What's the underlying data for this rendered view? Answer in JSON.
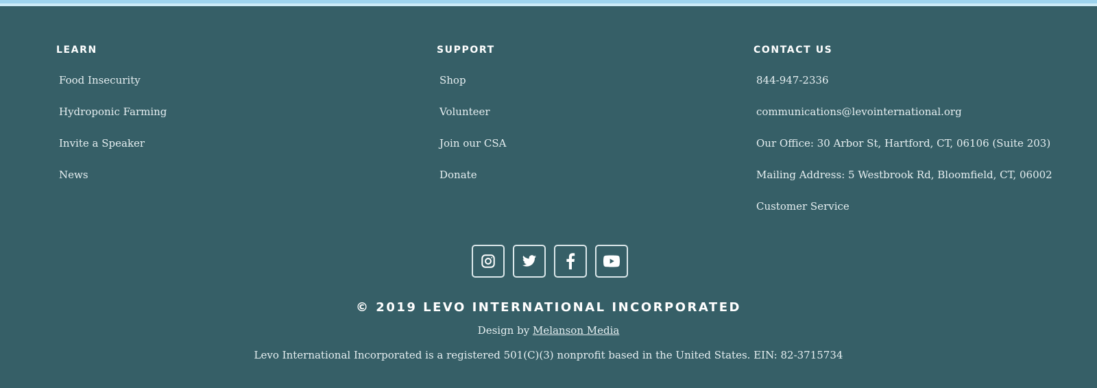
{
  "footer": {
    "learn": {
      "heading": "LEARN",
      "links": [
        "Food Insecurity",
        "Hydroponic Farming",
        "Invite a Speaker",
        "News"
      ]
    },
    "support": {
      "heading": "SUPPORT",
      "links": [
        "Shop",
        "Volunteer",
        "Join our CSA",
        "Donate"
      ]
    },
    "contact": {
      "heading": "CONTACT US",
      "links": [
        "844-947-2336",
        "communications@levointernational.org",
        "Our Office: 30 Arbor St, Hartford, CT, 06106 (Suite 203)",
        "Mailing Address: 5 Westbrook Rd, Bloomfield, CT, 06002",
        "Customer Service"
      ]
    },
    "social": {
      "icons": [
        "instagram-icon",
        "twitter-icon",
        "facebook-icon",
        "youtube-icon"
      ]
    },
    "copyright": "© 2019 LEVO INTERNATIONAL INCORPORATED",
    "design_by": {
      "prefix": "Design by ",
      "link": "Melanson Media"
    },
    "ein_statement": "Levo International Incorporated is a registered 501(C)(3) nonprofit based in the United States. EIN: 82-3715734"
  },
  "colors": {
    "background": "#365f67",
    "top_strip": "#9fd4ee",
    "text": "#e6eff1",
    "heading": "#ffffff"
  }
}
